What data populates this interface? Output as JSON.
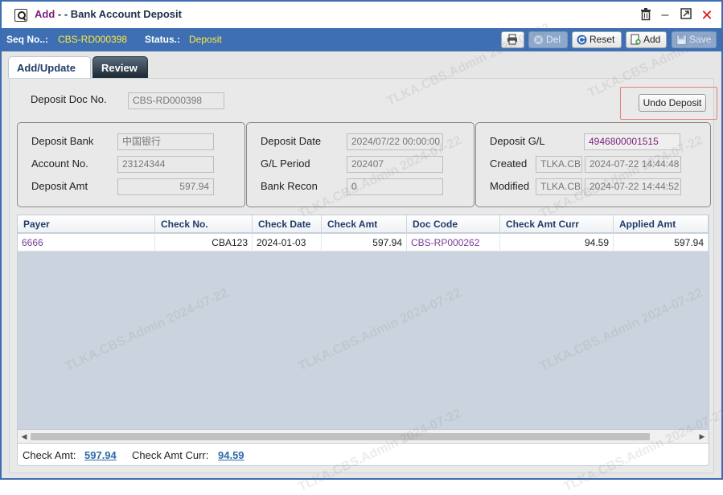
{
  "title": {
    "mode": "Add",
    "separator": " - - ",
    "text": "Bank Account Deposit"
  },
  "status_bar": {
    "seq_label": "Seq No..:",
    "seq_value": "CBS-RD000398",
    "status_label": "Status.:",
    "status_value": "Deposit"
  },
  "toolbar": {
    "print_label": "",
    "del_label": "Del",
    "reset_label": "Reset",
    "add_label": "Add",
    "save_label": "Save"
  },
  "tabs": [
    {
      "label": "Add/Update",
      "active": true
    },
    {
      "label": "Review",
      "active": false
    }
  ],
  "form": {
    "deposit_doc_label": "Deposit Doc No.",
    "deposit_doc_value": "CBS-RD000398",
    "undo_label": "Undo Deposit",
    "deposit_bank_label": "Deposit Bank",
    "deposit_bank_value": "中国银行",
    "account_no_label": "Account No.",
    "account_no_value": "23124344",
    "deposit_amt_label": "Deposit Amt",
    "deposit_amt_value": "597.94",
    "deposit_date_label": "Deposit Date",
    "deposit_date_value": "2024/07/22 00:00:00",
    "gl_period_label": "G/L Period",
    "gl_period_value": "202407",
    "bank_recon_label": "Bank Recon",
    "bank_recon_value": "0",
    "deposit_gl_label": "Deposit G/L",
    "deposit_gl_value": "4946800001515",
    "created_label": "Created",
    "created_user": "TLKA.CB",
    "created_time": "2024-07-22 14:44:48",
    "modified_label": "Modified",
    "modified_user": "TLKA.CB",
    "modified_time": "2024-07-22 14:44:52"
  },
  "grid": {
    "columns": [
      "Payer",
      "Check No.",
      "Check Date",
      "Check Amt",
      "Doc Code",
      "Check Amt Curr",
      "Applied Amt"
    ],
    "rows": [
      [
        "6666",
        "CBA123",
        "2024-01-03",
        "597.94",
        "CBS-RP000262",
        "94.59",
        "597.94"
      ]
    ]
  },
  "footer": {
    "check_amt_label": "Check Amt:",
    "check_amt_value": "597.94",
    "check_amt_curr_label": "Check Amt Curr:",
    "check_amt_curr_value": "94.59"
  },
  "watermark": "TLKA.CBS.Admin 2024-07-22",
  "colors": {
    "accent": "#3e6fb2",
    "status_value": "#ffe93f",
    "link": "#7a3c9a",
    "close": "#d11111"
  }
}
